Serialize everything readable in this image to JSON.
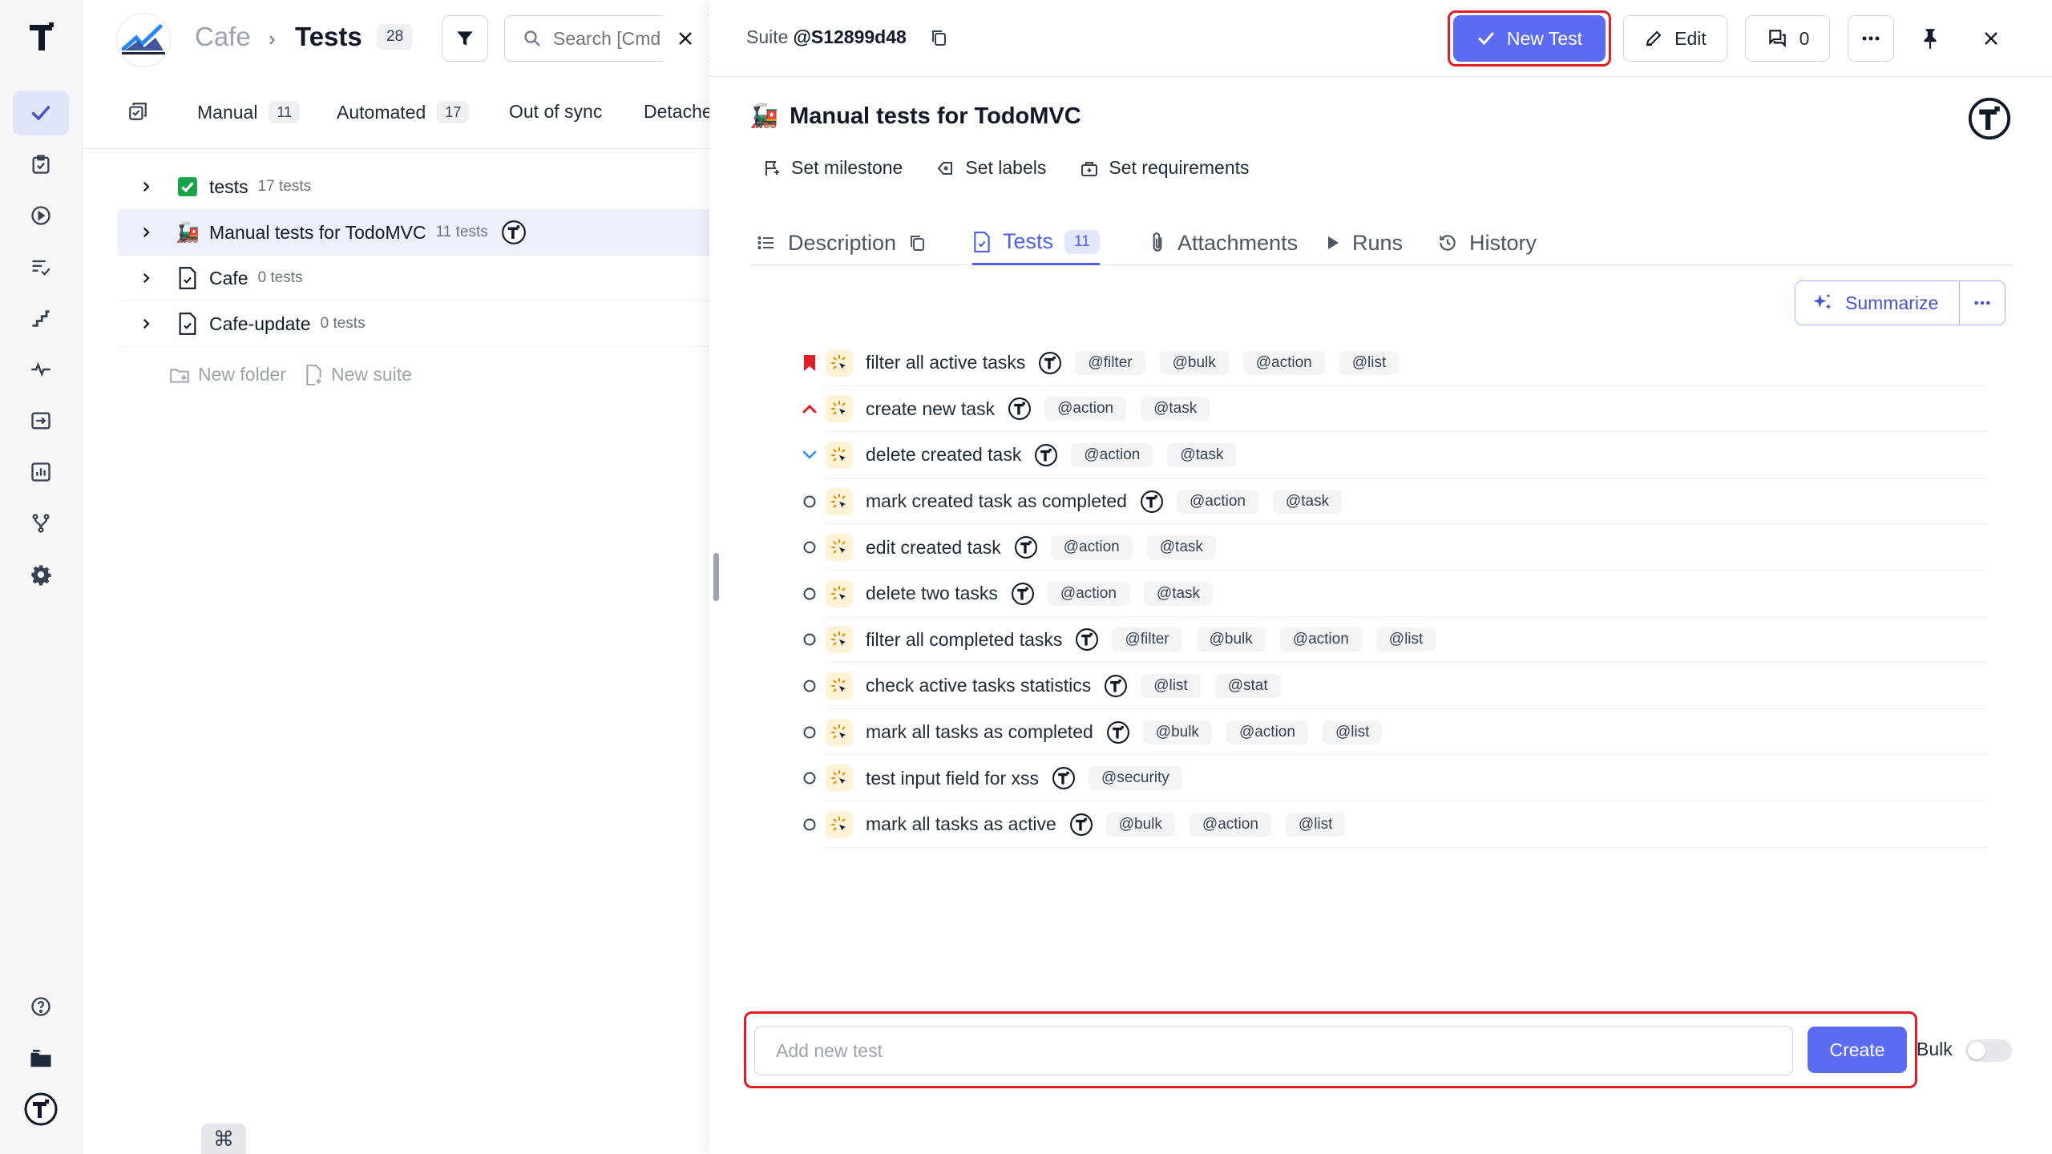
{
  "nav": {
    "logo_icon": "testomatio-logo",
    "items": [
      {
        "name": "tests",
        "icon": "check-icon",
        "active": true
      },
      {
        "name": "runs",
        "icon": "clipboard-check-icon"
      },
      {
        "name": "run",
        "icon": "play-circle-icon"
      },
      {
        "name": "plans",
        "icon": "list-check-icon"
      },
      {
        "name": "steps",
        "icon": "stairs-icon"
      },
      {
        "name": "pulse",
        "icon": "pulse-icon"
      },
      {
        "name": "imports",
        "icon": "import-icon"
      },
      {
        "name": "analytics",
        "icon": "bar-chart-icon"
      },
      {
        "name": "branches",
        "icon": "branch-icon"
      },
      {
        "name": "settings",
        "icon": "gear-icon"
      }
    ],
    "bottom": [
      "help-icon",
      "folder-icon",
      "account-logo"
    ]
  },
  "header": {
    "project": "Cafe",
    "separator": "›",
    "title": "Tests",
    "count": "28",
    "search_placeholder": "Search [Cmd"
  },
  "filters": [
    {
      "label": "Manual",
      "count": "11"
    },
    {
      "label": "Automated",
      "count": "17"
    },
    {
      "label": "Out of sync",
      "count": ""
    },
    {
      "label": "Detache",
      "count": ""
    }
  ],
  "tree": [
    {
      "name": "tests",
      "count": "17 tests",
      "icon": "check-box-icon",
      "selected": false
    },
    {
      "name": "Manual tests for TodoMVC",
      "count": "11 tests",
      "icon": "train-icon",
      "selected": true
    },
    {
      "name": "Cafe",
      "count": "0 tests",
      "icon": "file-icon",
      "selected": false
    },
    {
      "name": "Cafe-update",
      "count": "0 tests",
      "icon": "file-icon",
      "selected": false
    }
  ],
  "tree_actions": {
    "new_folder": "New folder",
    "new_suite": "New suite"
  },
  "cmd_label": "⌘",
  "detail": {
    "suite_prefix": "Suite",
    "suite_id": "@S12899d48",
    "new_test": "New Test",
    "edit": "Edit",
    "comments": "0",
    "title_icon": "🚂",
    "title": "Manual tests for TodoMVC",
    "meta": {
      "milestone": "Set milestone",
      "labels": "Set labels",
      "requirements": "Set requirements"
    },
    "tabs": {
      "description": "Description",
      "tests": "Tests",
      "tests_count": "11",
      "attachments": "Attachments",
      "runs": "Runs",
      "history": "History"
    },
    "summarize": "Summarize",
    "tests": [
      {
        "priority": "critical",
        "name": "filter all active tasks",
        "tags": [
          "@filter",
          "@bulk",
          "@action",
          "@list"
        ]
      },
      {
        "priority": "high",
        "name": "create new task",
        "tags": [
          "@action",
          "@task"
        ]
      },
      {
        "priority": "low",
        "name": "delete created task",
        "tags": [
          "@action",
          "@task"
        ]
      },
      {
        "priority": "normal",
        "name": "mark created task as completed",
        "tags": [
          "@action",
          "@task"
        ]
      },
      {
        "priority": "normal",
        "name": "edit created task",
        "tags": [
          "@action",
          "@task"
        ]
      },
      {
        "priority": "normal",
        "name": "delete two tasks",
        "tags": [
          "@action",
          "@task"
        ]
      },
      {
        "priority": "normal",
        "name": "filter all completed tasks",
        "tags": [
          "@filter",
          "@bulk",
          "@action",
          "@list"
        ]
      },
      {
        "priority": "normal",
        "name": "check active tasks statistics",
        "tags": [
          "@list",
          "@stat"
        ]
      },
      {
        "priority": "normal",
        "name": "mark all tasks as completed",
        "tags": [
          "@bulk",
          "@action",
          "@list"
        ]
      },
      {
        "priority": "normal",
        "name": "test input field for xss",
        "tags": [
          "@security"
        ]
      },
      {
        "priority": "normal",
        "name": "mark all tasks as active",
        "tags": [
          "@bulk",
          "@action",
          "@list"
        ]
      }
    ],
    "add_placeholder": "Add new test",
    "create": "Create",
    "bulk": "Bulk",
    "bulk_enabled": false
  },
  "colors": {
    "accent": "#5b6cf2",
    "highlight": "#e11d2a",
    "critical": "#e11d2a"
  }
}
